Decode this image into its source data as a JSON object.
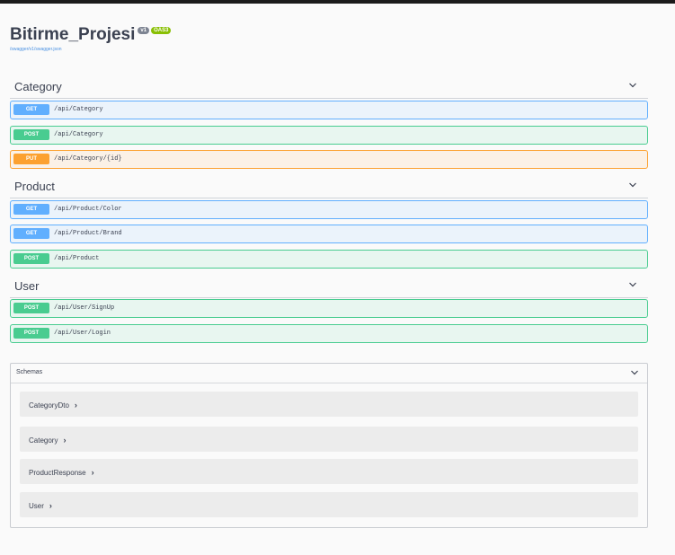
{
  "info": {
    "title": "Bitirme_Projesi",
    "version_badge": "v1",
    "oas_badge": "OAS3",
    "spec_url": "/swagger/v1/swagger.json"
  },
  "tags": [
    {
      "name": "Category",
      "operations": [
        {
          "method": "GET",
          "path": "/api/Category"
        },
        {
          "method": "POST",
          "path": "/api/Category"
        },
        {
          "method": "PUT",
          "path": "/api/Category/{id}"
        }
      ]
    },
    {
      "name": "Product",
      "operations": [
        {
          "method": "GET",
          "path": "/api/Product/Color"
        },
        {
          "method": "GET",
          "path": "/api/Product/Brand"
        },
        {
          "method": "POST",
          "path": "/api/Product"
        }
      ]
    },
    {
      "name": "User",
      "operations": [
        {
          "method": "POST",
          "path": "/api/User/SignUp"
        },
        {
          "method": "POST",
          "path": "/api/User/Login"
        }
      ]
    }
  ],
  "schemas": {
    "title": "Schemas",
    "models": [
      {
        "name": "CategoryDto",
        "chevron": "›"
      },
      {
        "name": "Category",
        "chevron": "›"
      },
      {
        "name": "ProductResponse",
        "chevron": "›"
      },
      {
        "name": "User",
        "chevron": "›"
      }
    ]
  },
  "colors": {
    "get": "#61affe",
    "post": "#49cc90",
    "put": "#fca130",
    "oas_badge": "#89bf04",
    "version_badge": "#7d8492"
  },
  "icons": {
    "tag_toggle": "chevron-down-icon",
    "schemas_toggle": "chevron-down-icon",
    "model_expand": "chevron-right-icon"
  }
}
